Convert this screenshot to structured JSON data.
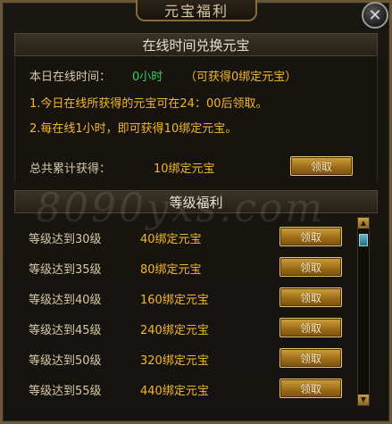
{
  "window": {
    "title": "元宝福利",
    "close_glyph": "✕"
  },
  "online_section": {
    "header": "在线时间兑换元宝",
    "today_label": "本日在线时间：",
    "today_value": "0小时",
    "today_bonus": "（可获得0绑定元宝）",
    "rule1": "1.今日在线所获得的元宝可在24：00后领取。",
    "rule2": "2.每在线1小时，即可获得10绑定元宝。",
    "total_label": "总共累计获得：",
    "total_value": "10绑定元宝",
    "claim_label": "领取"
  },
  "level_section": {
    "header": "等级福利",
    "rows": [
      {
        "level": "等级达到30级",
        "reward": "40绑定元宝",
        "button": "领取"
      },
      {
        "level": "等级达到35级",
        "reward": "80绑定元宝",
        "button": "领取"
      },
      {
        "level": "等级达到40级",
        "reward": "160绑定元宝",
        "button": "领取"
      },
      {
        "level": "等级达到45级",
        "reward": "240绑定元宝",
        "button": "领取"
      },
      {
        "level": "等级达到50级",
        "reward": "320绑定元宝",
        "button": "领取"
      },
      {
        "level": "等级达到55级",
        "reward": "440绑定元宝",
        "button": "领取"
      }
    ]
  },
  "watermark": "8090yxs.com",
  "colors": {
    "frame": "#6b5638",
    "green": "#34d25a",
    "yellow": "#f3b72a",
    "label": "#d6c9a6"
  }
}
